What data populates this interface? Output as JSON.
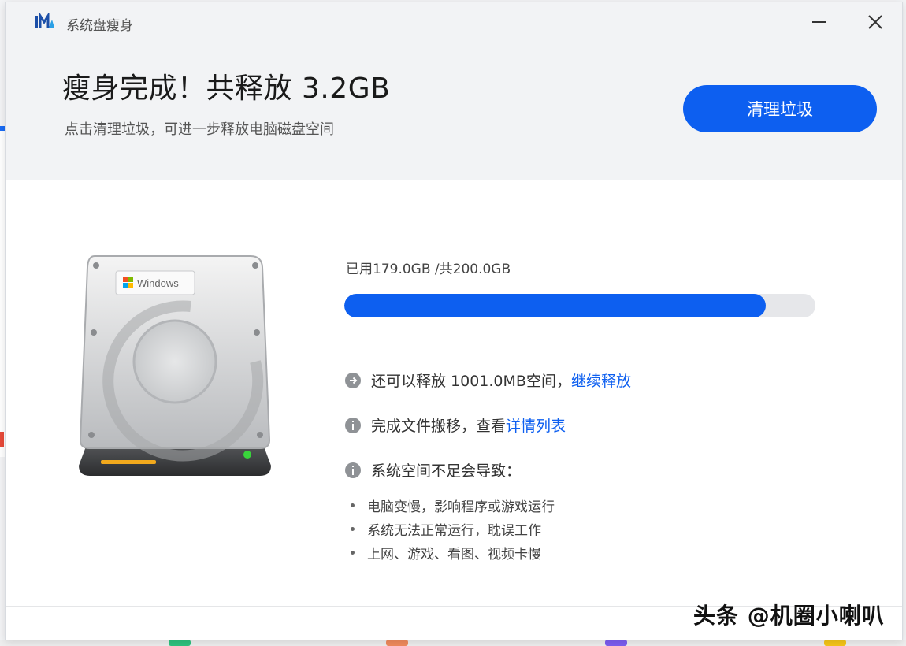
{
  "window": {
    "title": "系统盘瘦身",
    "minimize_icon": "minimize-icon",
    "close_icon": "close-icon"
  },
  "header": {
    "headline": "瘦身完成！共释放 3.2GB",
    "subline": "点击清理垃圾，可进一步释放电脑磁盘空间",
    "clean_button": "清理垃圾"
  },
  "disk": {
    "icon": "hard-disk-icon",
    "label": "Windows"
  },
  "usage": {
    "text": "已用179.0GB /共200.0GB",
    "used_fraction": 0.895
  },
  "info": {
    "release": {
      "icon": "arrow-right-circle-icon",
      "text": "还可以释放 1001.0MB空间，",
      "link": "继续释放"
    },
    "move": {
      "icon": "info-circle-icon",
      "text": "完成文件搬移，查看",
      "link": "详情列表"
    },
    "warning": {
      "icon": "info-circle-icon",
      "text": "系统空间不足会导致："
    }
  },
  "bullets": [
    "电脑变慢，影响程序或游戏运行",
    "系统无法正常运行，耽误工作",
    "上网、游戏、看图、视频卡慢"
  ],
  "watermark": "头条 @机圈小喇叭",
  "colors": {
    "accent": "#0d5ff0",
    "header_bg": "#f2f3f5",
    "track": "#e6e7ea"
  }
}
